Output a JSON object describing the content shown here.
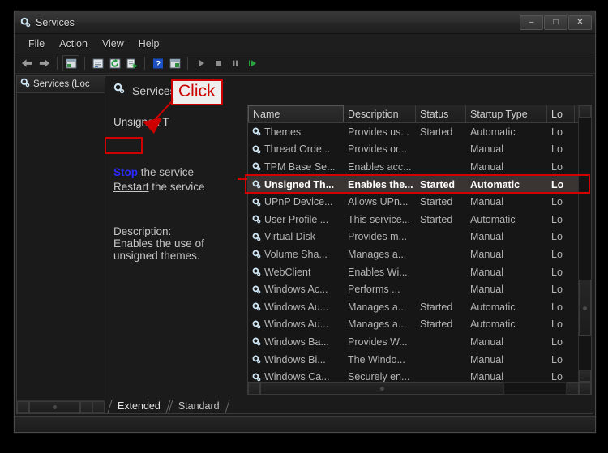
{
  "window": {
    "title": "Services",
    "icon": "services-gear-icon",
    "buttons": {
      "minimize": "–",
      "maximize": "□",
      "close": "✕"
    }
  },
  "menubar": {
    "items": [
      {
        "label": "File"
      },
      {
        "label": "Action"
      },
      {
        "label": "View"
      },
      {
        "label": "Help"
      }
    ]
  },
  "toolbar": {
    "items": [
      {
        "name": "back-arrow-icon"
      },
      {
        "name": "forward-arrow-icon"
      },
      {
        "name": "show-hide-console-tree-icon"
      },
      {
        "name": "properties-icon"
      },
      {
        "name": "refresh-icon"
      },
      {
        "name": "export-list-icon"
      },
      {
        "name": "help-icon"
      },
      {
        "name": "show-hide-action-pane-icon"
      },
      {
        "name": "start-service-icon"
      },
      {
        "name": "stop-service-icon"
      },
      {
        "name": "pause-service-icon"
      },
      {
        "name": "restart-service-icon"
      }
    ]
  },
  "tree": {
    "root_label": "Services (Loc"
  },
  "detail": {
    "pane_title": "Services (Local)",
    "service_name": "Unsigned T",
    "stop_link": "Stop",
    "stop_suffix": " the service",
    "restart_link": "Restart",
    "restart_suffix": " the service",
    "description_heading": "Description:",
    "description_lines": [
      "Enables the use of",
      "unsigned themes."
    ]
  },
  "annotations": {
    "click_label": "Click",
    "callout_border_color": "#cc0000",
    "callout_bg_color": "#eeeeee",
    "arrow_color": "#cc0000",
    "highlight_color": "#d40000"
  },
  "list": {
    "columns": [
      {
        "key": "name",
        "label": "Name"
      },
      {
        "key": "desc",
        "label": "Description"
      },
      {
        "key": "status",
        "label": "Status"
      },
      {
        "key": "startup",
        "label": "Startup Type"
      },
      {
        "key": "logon",
        "label": "Lo"
      }
    ],
    "rows": [
      {
        "name": "Themes",
        "desc": "Provides us...",
        "status": "Started",
        "startup": "Automatic",
        "logon": "Lo",
        "selected": false
      },
      {
        "name": "Thread Orde...",
        "desc": "Provides or...",
        "status": "",
        "startup": "Manual",
        "logon": "Lo",
        "selected": false
      },
      {
        "name": "TPM Base Se...",
        "desc": "Enables acc...",
        "status": "",
        "startup": "Manual",
        "logon": "Lo",
        "selected": false
      },
      {
        "name": "Unsigned Th...",
        "desc": "Enables the...",
        "status": "Started",
        "startup": "Automatic",
        "logon": "Lo",
        "selected": true
      },
      {
        "name": "UPnP Device...",
        "desc": "Allows UPn...",
        "status": "Started",
        "startup": "Manual",
        "logon": "Lo",
        "selected": false
      },
      {
        "name": "User Profile ...",
        "desc": "This service...",
        "status": "Started",
        "startup": "Automatic",
        "logon": "Lo",
        "selected": false
      },
      {
        "name": "Virtual Disk",
        "desc": "Provides m...",
        "status": "",
        "startup": "Manual",
        "logon": "Lo",
        "selected": false
      },
      {
        "name": "Volume Sha...",
        "desc": "Manages a...",
        "status": "",
        "startup": "Manual",
        "logon": "Lo",
        "selected": false
      },
      {
        "name": "WebClient",
        "desc": "Enables Wi...",
        "status": "",
        "startup": "Manual",
        "logon": "Lo",
        "selected": false
      },
      {
        "name": "Windows Ac...",
        "desc": "Performs ...",
        "status": "",
        "startup": "Manual",
        "logon": "Lo",
        "selected": false
      },
      {
        "name": "Windows Au...",
        "desc": "Manages a...",
        "status": "Started",
        "startup": "Automatic",
        "logon": "Lo",
        "selected": false
      },
      {
        "name": "Windows Au...",
        "desc": "Manages a...",
        "status": "Started",
        "startup": "Automatic",
        "logon": "Lo",
        "selected": false
      },
      {
        "name": "Windows Ba...",
        "desc": "Provides W...",
        "status": "",
        "startup": "Manual",
        "logon": "Lo",
        "selected": false
      },
      {
        "name": "Windows Bi...",
        "desc": "The Windo...",
        "status": "",
        "startup": "Manual",
        "logon": "Lo",
        "selected": false
      },
      {
        "name": "Windows Ca...",
        "desc": "Securely en...",
        "status": "",
        "startup": "Manual",
        "logon": "Lo",
        "selected": false
      }
    ]
  },
  "tabs": [
    {
      "label": "Extended",
      "active": true
    },
    {
      "label": "Standard",
      "active": false
    }
  ]
}
